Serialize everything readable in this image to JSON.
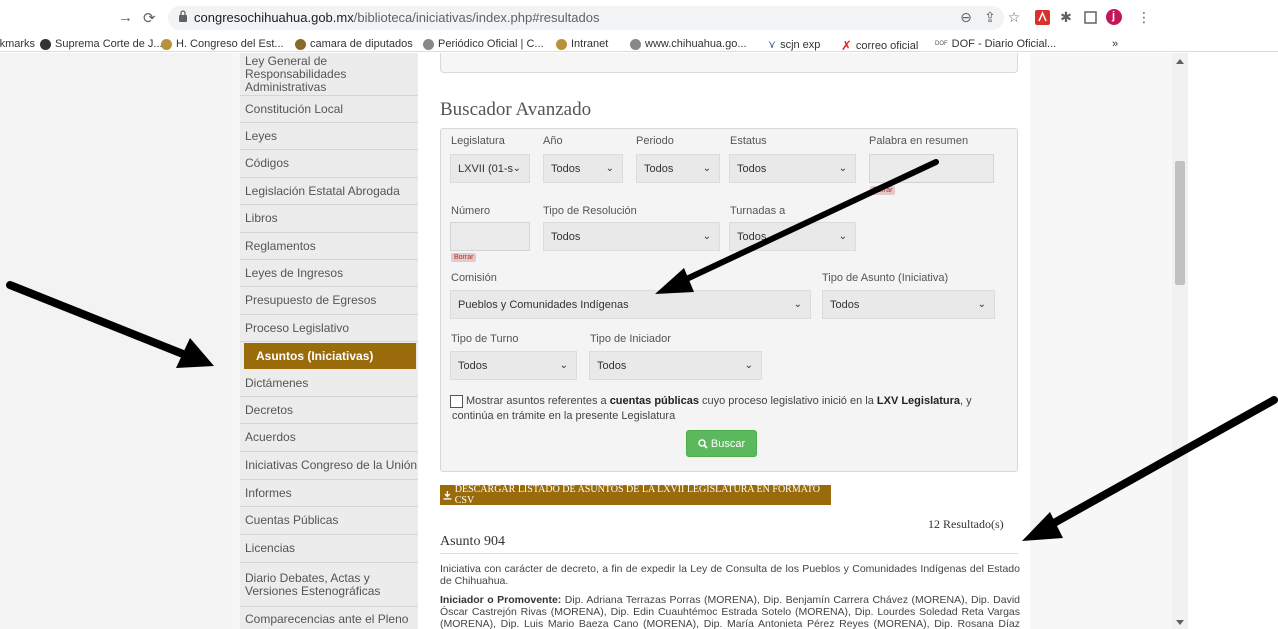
{
  "browser": {
    "url_host": "congresochihuahua.gob.mx",
    "url_path": "/biblioteca/iniciativas/index.php#resultados",
    "profile_initial": "j",
    "more_label": "»"
  },
  "bookmarks": [
    "Bookmarks",
    "Suprema Corte de J...",
    "H. Congreso del Est...",
    "camara de diputados",
    "Periódico Oficial | C...",
    "Intranet",
    "www.chihuahua.go...",
    "scjn exp",
    "correo oficial",
    "DOF - Diario Oficial..."
  ],
  "sidebar": {
    "items": [
      "Ley General de Responsabilidades Administrativas",
      "Constitución Local",
      "Leyes",
      "Códigos",
      "Legislación Estatal Abrogada",
      "Libros",
      "Reglamentos",
      "Leyes de Ingresos",
      "Presupuesto de Egresos",
      "Proceso Legislativo",
      "Asuntos (Iniciativas)",
      "Dictámenes",
      "Decretos",
      "Acuerdos",
      "Iniciativas Congreso de la Unión",
      "Informes",
      "Cuentas Públicas",
      "Licencias",
      "Diario Debates, Actas y Versiones Estenográficas",
      "Comparecencias ante el Pleno"
    ],
    "active_index": 10
  },
  "search": {
    "title": "Buscador Avanzado",
    "labels": {
      "legislatura": "Legislatura",
      "anio": "Año",
      "periodo": "Periodo",
      "estatus": "Estatus",
      "palabra": "Palabra en resumen",
      "numero": "Número",
      "tipo_resolucion": "Tipo de Resolución",
      "turnadas": "Turnadas a",
      "comision": "Comisión",
      "tipo_asunto": "Tipo de Asunto (Iniciativa)",
      "tipo_turno": "Tipo de Turno",
      "tipo_iniciador": "Tipo de Iniciador"
    },
    "values": {
      "legislatura": "LXVII (01-s",
      "anio": "Todos",
      "periodo": "Todos",
      "estatus": "Todos",
      "tipo_resolucion": "Todos",
      "turnadas": "Todos",
      "comision": "Pueblos y Comunidades Indígenas",
      "tipo_asunto": "Todos",
      "tipo_turno": "Todos",
      "tipo_iniciador": "Todos"
    },
    "borrar_label": "Borrar",
    "checkbox_pre": "Mostrar asuntos referentes a ",
    "checkbox_bold1": "cuentas públicas",
    "checkbox_mid": " cuyo proceso legislativo inició en la ",
    "checkbox_bold2": "LXV Legislatura",
    "checkbox_post": ", y continúa en trámite en la presente Legislatura",
    "buscar_label": "Buscar"
  },
  "csv_button": "DESCARGAR LISTADO DE ASUNTOS DE LA LXVII LEGISLATURA EN FORMATO CSV",
  "results_count": "12 Resultado(s)",
  "asunto": {
    "title": "Asunto 904",
    "description": "Iniciativa con carácter de decreto, a fin de expedir la Ley de Consulta de los Pueblos y Comunidades Indígenas del Estado de Chihuahua.",
    "initiator_label": "Iniciador o Promovente:",
    "initiator_text": " Dip. Adriana Terrazas Porras (MORENA), Dip. Benjamín Carrera Chávez (MORENA), Dip. David Óscar Castrejón Rivas (MORENA), Dip. Edin Cuauhtémoc Estrada Sotelo (MORENA), Dip. Lourdes Soledad Reta Vargas (MORENA), Dip. Luis Mario Baeza Cano (MORENA), Dip. María Antonieta Pérez Reyes (MORENA), Dip. Rosana Díaz Reyes (MORENA), Dip."
  },
  "colors": {
    "accent_brown": "#9a6b0b",
    "buscar_green": "#5cb85c"
  }
}
